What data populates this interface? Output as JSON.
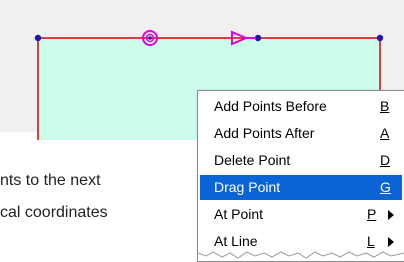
{
  "body": {
    "line1": "nts to the next",
    "line2": "cal coordinates"
  },
  "menu": {
    "items": [
      {
        "label": "Add Points Before",
        "key": "B"
      },
      {
        "label": "Add Points After",
        "key": "A"
      },
      {
        "label": "Delete Point",
        "key": "D"
      },
      {
        "label": "Drag Point",
        "key": "G"
      },
      {
        "label": "At Point",
        "key": "P"
      },
      {
        "label": "At Line",
        "key": "L"
      }
    ]
  },
  "colors": {
    "shape_fill": "#ccfcec",
    "shape_border": "#e00000",
    "vertex": "#1a1ab0",
    "handle": "#e000e0",
    "selection": "#0a64d6"
  }
}
